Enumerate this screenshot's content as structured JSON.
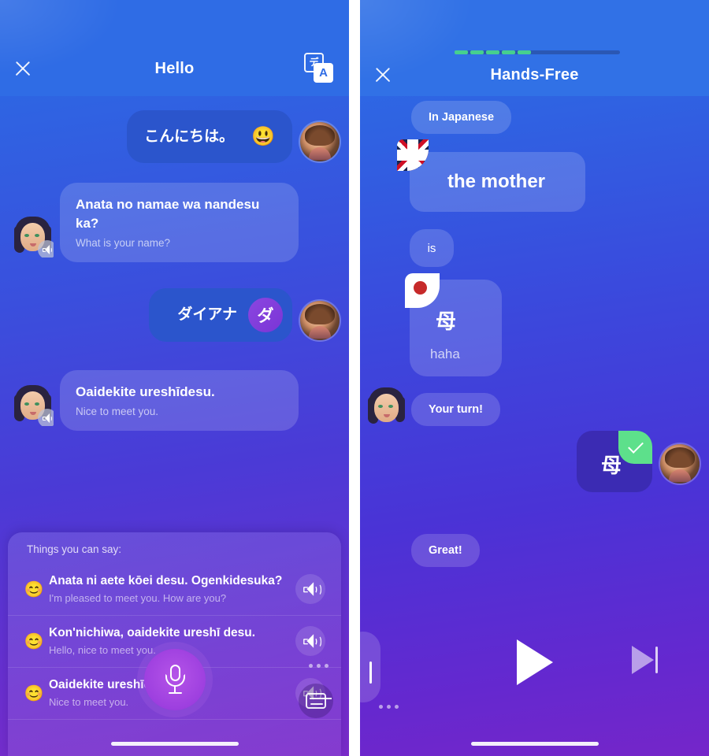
{
  "left_phone": {
    "header": {
      "title": "Hello",
      "close_label": "close-icon",
      "translate_icon_back": "デ",
      "translate_icon_front": "A"
    },
    "messages": [
      {
        "side": "out",
        "main": "こんにちは。",
        "emoji": "😃",
        "sub": ""
      },
      {
        "side": "in",
        "main": "Anata no namae wa nandesu ka?",
        "sub": "What is your name?"
      },
      {
        "side": "out",
        "main": "ダイアナ",
        "kana": "ダ",
        "sub": ""
      },
      {
        "side": "in",
        "main": "Oaidekite ureshīdesu.",
        "sub": "Nice to meet you."
      }
    ],
    "suggestions": {
      "title": "Things you can say:",
      "items": [
        {
          "emoji": "😊",
          "main": "Anata ni aete kōei desu. Ogenkidesuka?",
          "sub": "I'm pleased to meet you. How are you?"
        },
        {
          "emoji": "😊",
          "main": "Kon'nichiwa, oaidekite ureshī desu.",
          "sub": "Hello, nice to meet you."
        },
        {
          "emoji": "😊",
          "main": "Oaidekite ureshīdesu.",
          "sub": "Nice to meet you."
        }
      ]
    },
    "controls": {
      "mic_label": "microphone-button",
      "more_label": "more-options",
      "keyboard_label": "keyboard-button"
    }
  },
  "right_phone": {
    "header": {
      "title": "Hands-Free",
      "close_label": "close-icon",
      "progress_total": 20,
      "progress_filled": 5
    },
    "content": {
      "mode_chip": "In Japanese",
      "english_card": {
        "flag": "uk-flag",
        "text": "the mother"
      },
      "connector_chip": "is",
      "japanese_card": {
        "flag": "japan-flag",
        "kanji": "母",
        "romaji": "haha"
      },
      "prompt_chip": "Your turn!",
      "answer_card": {
        "kanji": "母",
        "status": "correct"
      },
      "feedback_chip": "Great!"
    },
    "controls": {
      "pause_label": "pause-button",
      "play_label": "play-button",
      "next_label": "next-button",
      "more_label": "more-options"
    }
  },
  "colors": {
    "header_blue": "#2f6ce5",
    "bubble_out": "#2b55cc",
    "accent_purple": "#9d3fdf",
    "progress_green": "#46cf8f",
    "check_green": "#5de08b",
    "answer_card": "#3b2bb3"
  }
}
